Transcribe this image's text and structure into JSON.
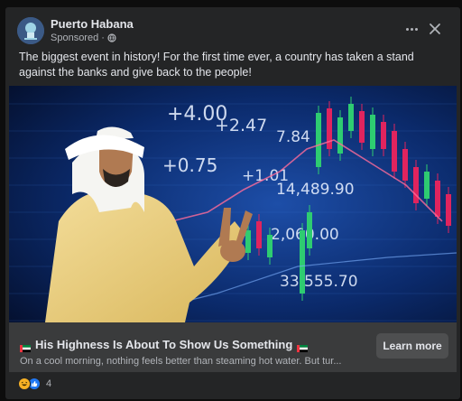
{
  "post": {
    "page_name": "Puerto Habana",
    "sponsored_label": "Sponsored",
    "separator": "·",
    "body_text": "The biggest event in history! For the first time ever, a country has taken a stand against the banks and give back to the people!"
  },
  "image": {
    "ticker_values": [
      "+4.00",
      "+2.47",
      "7.84",
      "+0.75",
      "+1.01",
      "14,489.90",
      "2,060.00",
      "33,555.70"
    ]
  },
  "ad": {
    "headline": "His Highness Is About To Show Us Something",
    "description": "On a cool morning, nothing feels better than steaming hot water. But tur...",
    "cta_label": "Learn more"
  },
  "reactions": {
    "count": "4",
    "types": [
      "haha-icon",
      "like-icon"
    ]
  },
  "colors": {
    "card_bg": "#242526",
    "cta_bar_bg": "#3a3b3c",
    "chart_bg": "#061a3d",
    "candle_up": "#2ecc71",
    "candle_down": "#e0245e"
  }
}
